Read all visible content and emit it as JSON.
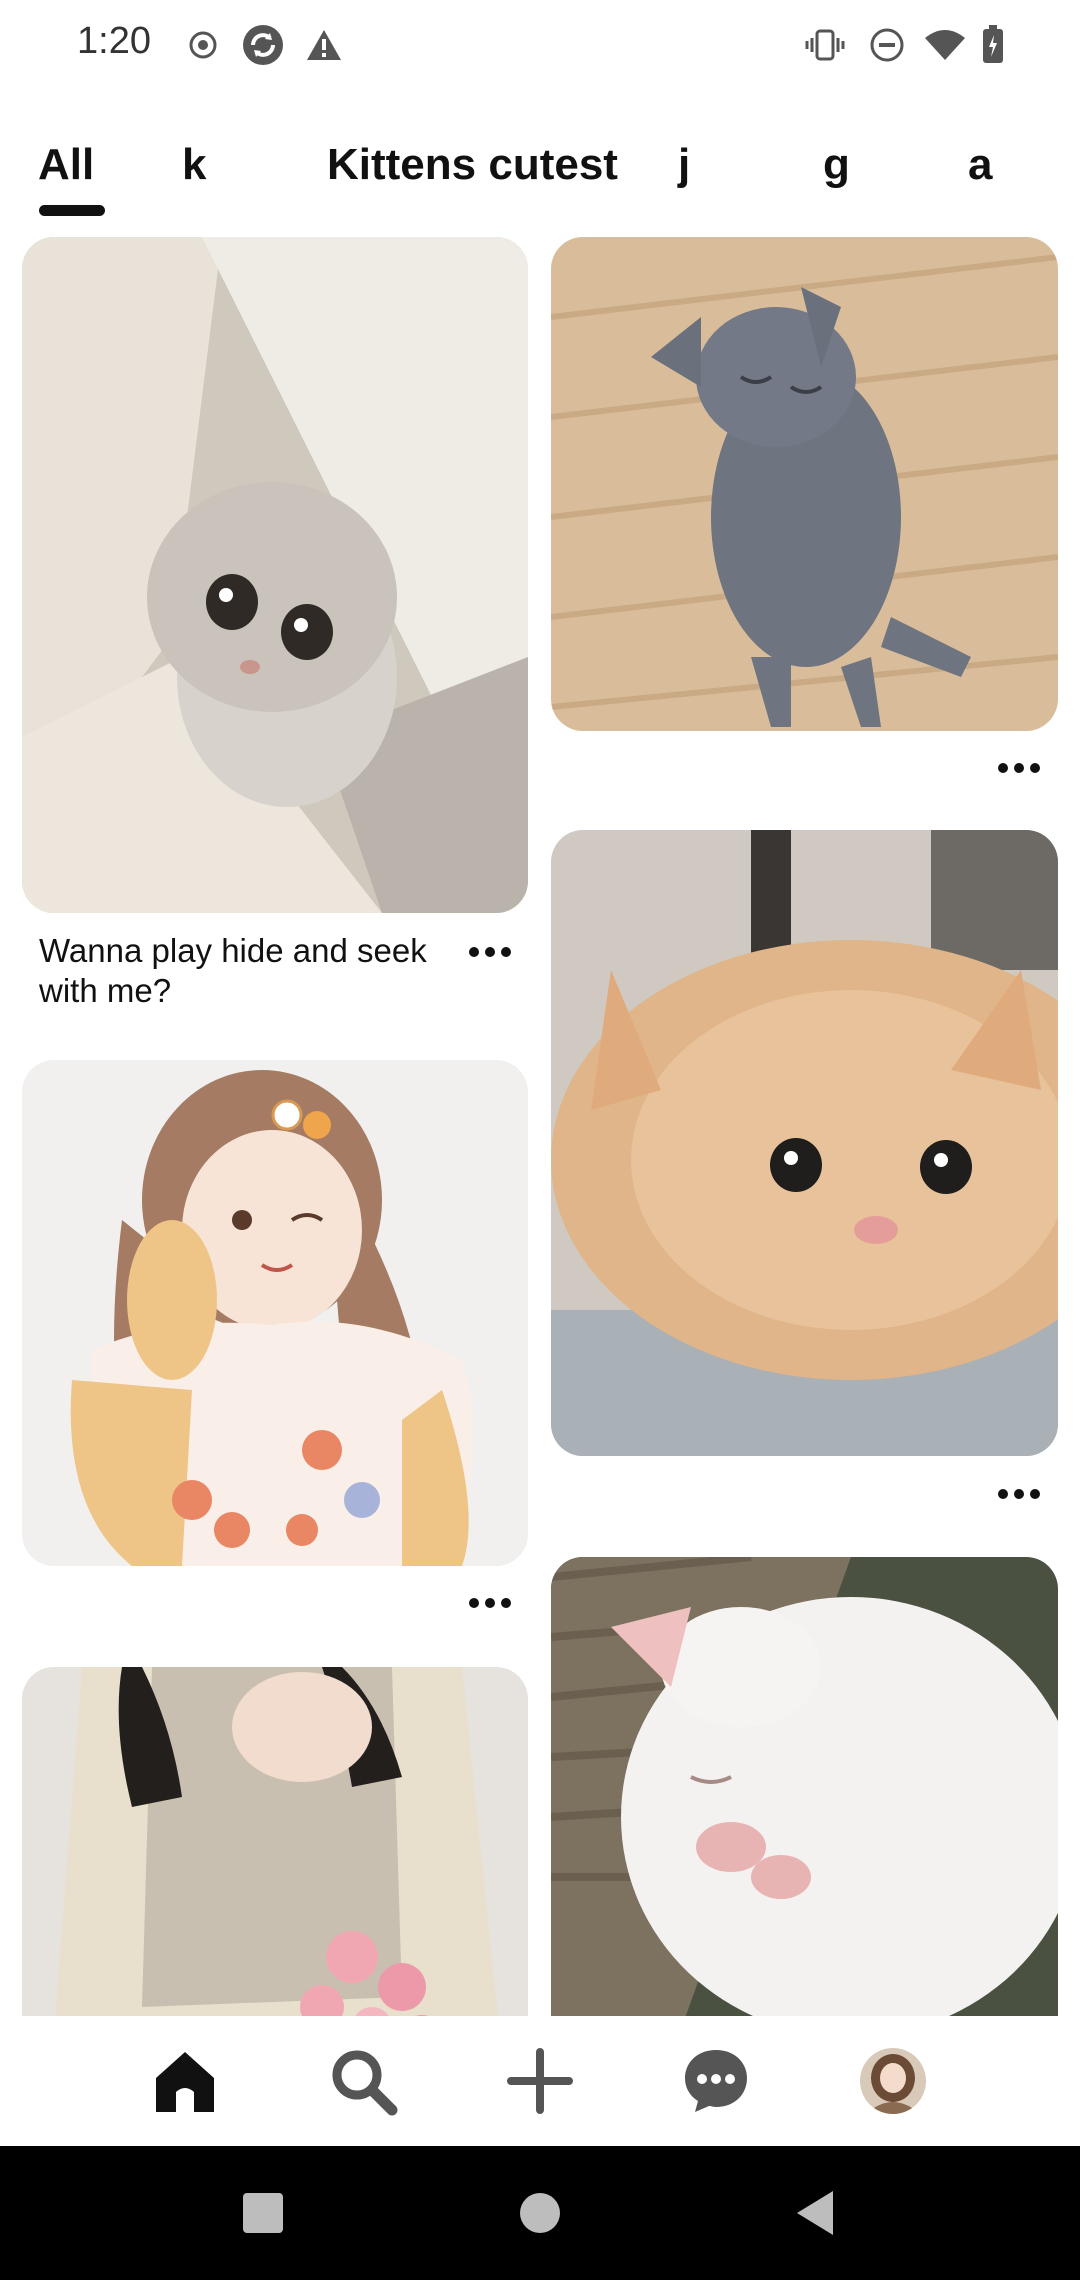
{
  "status_bar": {
    "time": "1:20",
    "left_icons": [
      "record-icon",
      "sync-icon",
      "warning-icon"
    ],
    "right_icons": [
      "vibrate-icon",
      "dnd-icon",
      "wifi-icon",
      "battery-icon"
    ]
  },
  "tabs": [
    {
      "label": "All",
      "selected": true
    },
    {
      "label": "k",
      "selected": false
    },
    {
      "label": "Kittens cutest",
      "selected": false
    },
    {
      "label": "j",
      "selected": false
    },
    {
      "label": "g",
      "selected": false
    },
    {
      "label": "a",
      "selected": false
    }
  ],
  "feed": {
    "pins": [
      {
        "id": "pin-hiding-cat",
        "caption": "Wanna play hide and seek with me?"
      },
      {
        "id": "pin-gray-kitten",
        "caption": ""
      },
      {
        "id": "pin-ginger-kitten",
        "caption": ""
      },
      {
        "id": "pin-girl-illustration",
        "caption": ""
      },
      {
        "id": "pin-white-kitten",
        "caption": ""
      },
      {
        "id": "pin-fashion-photo",
        "caption": ""
      }
    ]
  },
  "bottom_nav": {
    "items": [
      "home-icon",
      "search-icon",
      "create-icon",
      "messages-icon",
      "profile-avatar"
    ],
    "active": "home-icon"
  },
  "system_nav": [
    "recents-button",
    "home-button",
    "back-button"
  ]
}
